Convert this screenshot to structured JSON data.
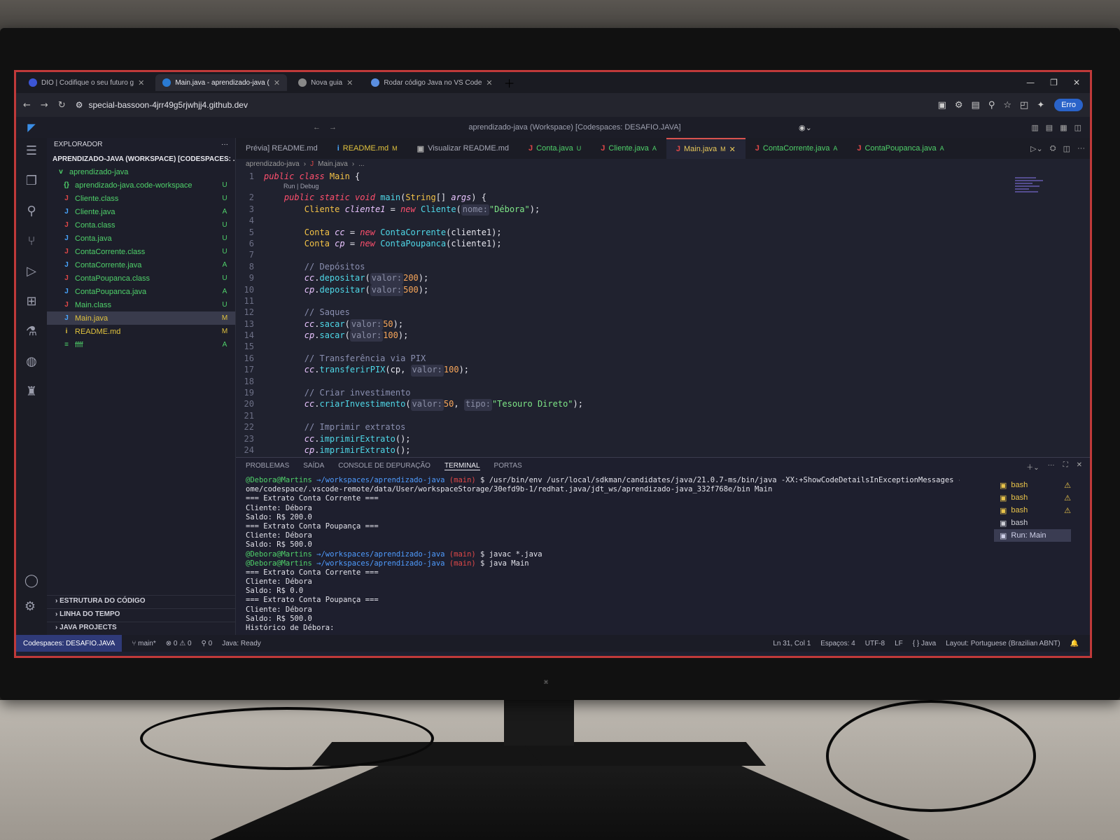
{
  "browser": {
    "tabs": [
      {
        "label": "DIO | Codifique o seu futuro g",
        "active": false
      },
      {
        "label": "Main.java - aprendizado-java (",
        "active": true
      },
      {
        "label": "Nova guia",
        "active": false
      },
      {
        "label": "Rodar código Java no VS Code",
        "active": false
      }
    ],
    "url": "special-bassoon-4jrr49g5rjwhjj4.github.dev",
    "erro_label": "Erro"
  },
  "vscode": {
    "command_center": "aprendizado-java (Workspace) [Codespaces: DESAFIO.JAVA]",
    "explorer": {
      "header": "EXPLORADOR",
      "workspace_title": "APRENDIZADO-JAVA (WORKSPACE) [CODESPACES: ...",
      "items": [
        {
          "name": "aprendizado-java",
          "badge": "",
          "color": "#4fd16a",
          "icon": "v"
        },
        {
          "name": "aprendizado-java.code-workspace",
          "badge": "U",
          "color": "#4fd16a",
          "icon": "{}"
        },
        {
          "name": "Cliente.class",
          "badge": "U",
          "color": "#4fd16a",
          "icon": "J"
        },
        {
          "name": "Cliente.java",
          "badge": "A",
          "color": "#4fd16a",
          "icon": "J"
        },
        {
          "name": "Conta.class",
          "badge": "U",
          "color": "#4fd16a",
          "icon": "J"
        },
        {
          "name": "Conta.java",
          "badge": "U",
          "color": "#4fd16a",
          "icon": "J"
        },
        {
          "name": "ContaCorrente.class",
          "badge": "U",
          "color": "#4fd16a",
          "icon": "J"
        },
        {
          "name": "ContaCorrente.java",
          "badge": "A",
          "color": "#4fd16a",
          "icon": "J"
        },
        {
          "name": "ContaPoupanca.class",
          "badge": "U",
          "color": "#4fd16a",
          "icon": "J"
        },
        {
          "name": "ContaPoupanca.java",
          "badge": "A",
          "color": "#4fd16a",
          "icon": "J"
        },
        {
          "name": "Main.class",
          "badge": "U",
          "color": "#4fd16a",
          "icon": "J"
        },
        {
          "name": "Main.java",
          "badge": "M",
          "color": "#e0c23e",
          "icon": "J"
        },
        {
          "name": "README.md",
          "badge": "M",
          "color": "#e0c23e",
          "icon": "i"
        },
        {
          "name": "ffff",
          "badge": "A",
          "color": "#4fd16a",
          "icon": "≡"
        }
      ],
      "sections": [
        "ESTRUTURA DO CÓDIGO",
        "LINHA DO TEMPO",
        "JAVA PROJECTS"
      ]
    },
    "editor_tabs": [
      {
        "label": "Prévia] README.md",
        "status": "",
        "active": false,
        "icon": "",
        "color": "#a6a8b6"
      },
      {
        "label": "README.md",
        "status": "M",
        "active": false,
        "icon": "i",
        "color": "#e0c23e"
      },
      {
        "label": "Visualizar README.md",
        "status": "",
        "active": false,
        "icon": "▣",
        "color": "#a6a8b6"
      },
      {
        "label": "Conta.java",
        "status": "U",
        "active": false,
        "icon": "J",
        "color": "#4fd16a"
      },
      {
        "label": "Cliente.java",
        "status": "A",
        "active": false,
        "icon": "J",
        "color": "#4fd16a"
      },
      {
        "label": "Main.java",
        "status": "M",
        "active": true,
        "icon": "J",
        "color": "#e8c85a"
      },
      {
        "label": "ContaCorrente.java",
        "status": "A",
        "active": false,
        "icon": "J",
        "color": "#4fd16a"
      },
      {
        "label": "ContaPoupanca.java",
        "status": "A",
        "active": false,
        "icon": "J",
        "color": "#4fd16a"
      }
    ],
    "breadcrumb": [
      "aprendizado-java",
      "Main.java",
      "..."
    ],
    "codelens": "Run | Debug",
    "panel": {
      "tabs": [
        "PROBLEMAS",
        "SAÍDA",
        "CONSOLE DE DEPURAÇÃO",
        "TERMINAL",
        "PORTAS"
      ],
      "active_tab": "TERMINAL",
      "terminal_lines": [
        {
          "user": "@Debora@Martins",
          "path": "→/workspaces/aprendizado-java",
          "branch": "(main)",
          "rest": " $ /usr/bin/env /usr/local/sdkman/candidates/java/21.0.7-ms/bin/java -XX:+ShowCodeDetailsInExceptionMessages -cp /h"
        },
        {
          "text": "ome/codespace/.vscode-remote/data/User/workspaceStorage/30efd9b-1/redhat.java/jdt_ws/aprendizado-java_332f768e/bin Main"
        },
        {
          "text": "=== Extrato Conta Corrente ==="
        },
        {
          "text": "Cliente: Débora"
        },
        {
          "text": "Saldo: R$ 200.0"
        },
        {
          "text": "=== Extrato Conta Poupança ==="
        },
        {
          "text": "Cliente: Débora"
        },
        {
          "text": "Saldo: R$ 500.0"
        },
        {
          "user": "@Debora@Martins",
          "path": "→/workspaces/aprendizado-java",
          "branch": "(main)",
          "rest": " $ javac *.java"
        },
        {
          "user": "@Debora@Martins",
          "path": "→/workspaces/aprendizado-java",
          "branch": "(main)",
          "rest": " $ java Main"
        },
        {
          "text": "=== Extrato Conta Corrente ==="
        },
        {
          "text": "Cliente: Débora"
        },
        {
          "text": "Saldo: R$ 0.0"
        },
        {
          "text": "=== Extrato Conta Poupança ==="
        },
        {
          "text": "Cliente: Débora"
        },
        {
          "text": "Saldo: R$ 500.0"
        },
        {
          "text": "Histórico de Débora:"
        }
      ],
      "terminals": [
        {
          "label": "bash",
          "warn": true,
          "kind": "warn"
        },
        {
          "label": "bash",
          "warn": true,
          "kind": "warn"
        },
        {
          "label": "bash",
          "warn": true,
          "kind": "warn"
        },
        {
          "label": "bash",
          "warn": false,
          "kind": "plain"
        },
        {
          "label": "Run: Main",
          "warn": false,
          "kind": "active"
        }
      ]
    },
    "status": {
      "remote": "Codespaces: DESAFIO.JAVA",
      "branch": "main*",
      "problems": "⊗ 0 ⚠ 0",
      "ports": "⚲ 0",
      "java": "Java: Ready",
      "position": "Ln 31, Col 1",
      "spaces": "Espaços: 4",
      "encoding": "UTF-8",
      "eol": "LF",
      "language": "{ } Java",
      "layout": "Layout: Portuguese (Brazilian ABNT)"
    }
  },
  "code_lines": [
    {
      "n": "1",
      "tokens": [
        [
          "kw",
          "public class "
        ],
        [
          "ty",
          "Main"
        ],
        [
          "pl",
          " {"
        ]
      ]
    },
    {
      "n": "2",
      "tokens": [
        [
          "pl",
          "    "
        ],
        [
          "kw",
          "public static void "
        ],
        [
          "fn",
          "main"
        ],
        [
          "pl",
          "("
        ],
        [
          "ty",
          "String"
        ],
        [
          "pl",
          "[] "
        ],
        [
          "vr",
          "args"
        ],
        [
          "pl",
          ") {"
        ]
      ]
    },
    {
      "n": "3",
      "tokens": [
        [
          "pl",
          "        "
        ],
        [
          "ty",
          "Cliente "
        ],
        [
          "vr",
          "cliente1"
        ],
        [
          "pl",
          " = "
        ],
        [
          "kw",
          "new "
        ],
        [
          "fn",
          "Cliente"
        ],
        [
          "pl",
          "("
        ],
        [
          "hint",
          "nome:"
        ],
        [
          "st2",
          "\"Débora\""
        ],
        [
          "pl",
          ");"
        ]
      ]
    },
    {
      "n": "4",
      "tokens": []
    },
    {
      "n": "5",
      "tokens": [
        [
          "pl",
          "        "
        ],
        [
          "ty",
          "Conta "
        ],
        [
          "vr",
          "cc"
        ],
        [
          "pl",
          " = "
        ],
        [
          "kw",
          "new "
        ],
        [
          "fn",
          "ContaCorrente"
        ],
        [
          "pl",
          "(cliente1);"
        ]
      ]
    },
    {
      "n": "6",
      "tokens": [
        [
          "pl",
          "        "
        ],
        [
          "ty",
          "Conta "
        ],
        [
          "vr",
          "cp"
        ],
        [
          "pl",
          " = "
        ],
        [
          "kw",
          "new "
        ],
        [
          "fn",
          "ContaPoupanca"
        ],
        [
          "pl",
          "(cliente1);"
        ]
      ]
    },
    {
      "n": "7",
      "tokens": []
    },
    {
      "n": "8",
      "tokens": [
        [
          "cm",
          "        // Depósitos"
        ]
      ]
    },
    {
      "n": "9",
      "tokens": [
        [
          "pl",
          "        "
        ],
        [
          "vr",
          "cc"
        ],
        [
          "pl",
          "."
        ],
        [
          "fn",
          "depositar"
        ],
        [
          "pl",
          "("
        ],
        [
          "hint",
          "valor:"
        ],
        [
          "num",
          "200"
        ],
        [
          "pl",
          ");"
        ]
      ]
    },
    {
      "n": "10",
      "tokens": [
        [
          "pl",
          "        "
        ],
        [
          "vr",
          "cp"
        ],
        [
          "pl",
          "."
        ],
        [
          "fn",
          "depositar"
        ],
        [
          "pl",
          "("
        ],
        [
          "hint",
          "valor:"
        ],
        [
          "num",
          "500"
        ],
        [
          "pl",
          ");"
        ]
      ]
    },
    {
      "n": "11",
      "tokens": []
    },
    {
      "n": "12",
      "tokens": [
        [
          "cm",
          "        // Saques"
        ]
      ]
    },
    {
      "n": "13",
      "tokens": [
        [
          "pl",
          "        "
        ],
        [
          "vr",
          "cc"
        ],
        [
          "pl",
          "."
        ],
        [
          "fn",
          "sacar"
        ],
        [
          "pl",
          "("
        ],
        [
          "hint",
          "valor:"
        ],
        [
          "num",
          "50"
        ],
        [
          "pl",
          ");"
        ]
      ]
    },
    {
      "n": "14",
      "tokens": [
        [
          "pl",
          "        "
        ],
        [
          "vr",
          "cp"
        ],
        [
          "pl",
          "."
        ],
        [
          "fn",
          "sacar"
        ],
        [
          "pl",
          "("
        ],
        [
          "hint",
          "valor:"
        ],
        [
          "num",
          "100"
        ],
        [
          "pl",
          ");"
        ]
      ]
    },
    {
      "n": "15",
      "tokens": []
    },
    {
      "n": "16",
      "tokens": [
        [
          "cm",
          "        // Transferência via PIX"
        ]
      ]
    },
    {
      "n": "17",
      "tokens": [
        [
          "pl",
          "        "
        ],
        [
          "vr",
          "cc"
        ],
        [
          "pl",
          "."
        ],
        [
          "fn",
          "transferirPIX"
        ],
        [
          "pl",
          "(cp, "
        ],
        [
          "hint",
          "valor:"
        ],
        [
          "num",
          "100"
        ],
        [
          "pl",
          ");"
        ]
      ]
    },
    {
      "n": "18",
      "tokens": []
    },
    {
      "n": "19",
      "tokens": [
        [
          "cm",
          "        // Criar investimento"
        ]
      ]
    },
    {
      "n": "20",
      "tokens": [
        [
          "pl",
          "        "
        ],
        [
          "vr",
          "cc"
        ],
        [
          "pl",
          "."
        ],
        [
          "fn",
          "criarInvestimento"
        ],
        [
          "pl",
          "("
        ],
        [
          "hint",
          "valor:"
        ],
        [
          "num",
          "50"
        ],
        [
          "pl",
          ", "
        ],
        [
          "hint",
          "tipo:"
        ],
        [
          "st2",
          "\"Tesouro Direto\""
        ],
        [
          "pl",
          ");"
        ]
      ]
    },
    {
      "n": "21",
      "tokens": []
    },
    {
      "n": "22",
      "tokens": [
        [
          "cm",
          "        // Imprimir extratos"
        ]
      ]
    },
    {
      "n": "23",
      "tokens": [
        [
          "pl",
          "        "
        ],
        [
          "vr",
          "cc"
        ],
        [
          "pl",
          "."
        ],
        [
          "fn",
          "imprimirExtrato"
        ],
        [
          "pl",
          "();"
        ]
      ]
    },
    {
      "n": "24",
      "tokens": [
        [
          "pl",
          "        "
        ],
        [
          "vr",
          "cp"
        ],
        [
          "pl",
          "."
        ],
        [
          "fn",
          "imprimirExtrato"
        ],
        [
          "pl",
          "();"
        ]
      ]
    }
  ]
}
